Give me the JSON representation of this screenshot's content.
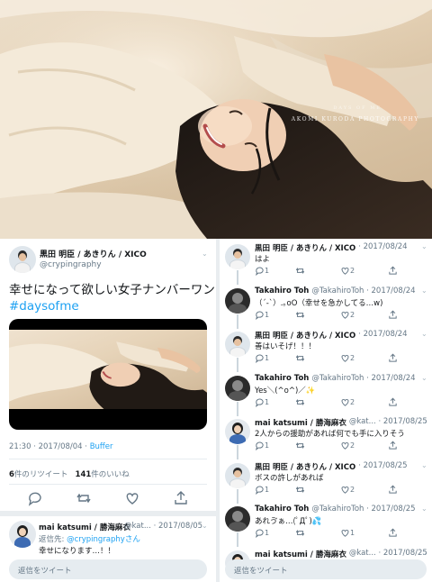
{
  "hero": {
    "watermark": "AKOMI KURODA PHOTOGRAPHY",
    "watermark_small": "DAYS OF ME"
  },
  "main_tweet": {
    "name": "黒田 明臣 / あきりん / XICO",
    "handle": "@crypingraphy",
    "text": "幸せになって欲しい女子ナンバーワン",
    "hashtag": "#daysofme",
    "time": "21:30 · 2017/08/04 · ",
    "via": "Buffer",
    "retweets_count": "6",
    "retweets_label": "件のリツイート",
    "likes_count": "141",
    "likes_label": "件のいいね"
  },
  "reply_left": {
    "name": "mai katsumi / 勝海麻衣",
    "handle": "@kat... · 2017/08/05",
    "to_prefix": "返信先: ",
    "to_user": "@crypingraphyさん",
    "text": "幸せになります…！！"
  },
  "compose": {
    "left_placeholder": "返信をツイート",
    "right_placeholder": "返信をツイート"
  },
  "thread": [
    {
      "name": "黒田 明臣 / あきりん / XICO",
      "handle": "· 2017/08/24",
      "text": "はよ",
      "replies": "1",
      "retweets": "",
      "likes": "2",
      "avatar": "a"
    },
    {
      "name": "Takahiro Toh",
      "handle": "@TakahiroToh · 2017/08/24",
      "text": "（´-`）.｡oO（幸せを急かしてる…w)",
      "replies": "1",
      "retweets": "",
      "likes": "2",
      "avatar": "t"
    },
    {
      "name": "黒田 明臣 / あきりん / XICO",
      "handle": "· 2017/08/24",
      "text": "善はいそげ！！！",
      "replies": "1",
      "retweets": "",
      "likes": "2",
      "avatar": "a"
    },
    {
      "name": "Takahiro Toh",
      "handle": "@TakahiroToh · 2017/08/24",
      "text": "Yes＼(^o^)／✨",
      "replies": "1",
      "retweets": "",
      "likes": "2",
      "avatar": "t"
    },
    {
      "name": "mai katsumi / 勝海麻衣",
      "handle": "@kat... · 2017/08/25",
      "text": "2人からの援助があれば何でも手に入りそう",
      "replies": "1",
      "retweets": "",
      "likes": "2",
      "avatar": "m"
    },
    {
      "name": "黒田 明臣 / あきりん / XICO",
      "handle": "· 2017/08/25",
      "text": "ボスの許しがあれば",
      "replies": "1",
      "retweets": "",
      "likes": "2",
      "avatar": "a"
    },
    {
      "name": "Takahiro Toh",
      "handle": "@TakahiroToh · 2017/08/25",
      "text": "あれゔぁ…(ﾟДﾟ)💦",
      "replies": "1",
      "retweets": "",
      "likes": "1",
      "avatar": "t"
    },
    {
      "name": "mai katsumi / 勝海麻衣",
      "handle": "@kat... · 2017/08/25",
      "text": "",
      "replies": "",
      "retweets": "",
      "likes": "",
      "avatar": "m"
    }
  ]
}
